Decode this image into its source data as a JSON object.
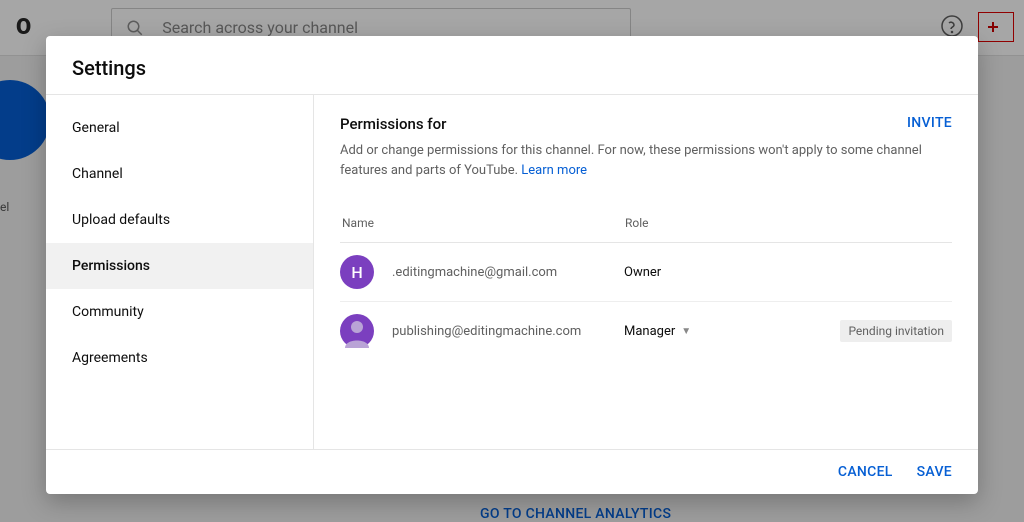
{
  "background": {
    "logo_text": "O",
    "search_placeholder": "Search across your channel",
    "channel_label": "el",
    "analytics_link": "GO TO CHANNEL ANALYTICS"
  },
  "modal": {
    "title": "Settings",
    "sidebar": {
      "items": [
        {
          "label": "General",
          "active": false
        },
        {
          "label": "Channel",
          "active": false
        },
        {
          "label": "Upload defaults",
          "active": false
        },
        {
          "label": "Permissions",
          "active": true
        },
        {
          "label": "Community",
          "active": false
        },
        {
          "label": "Agreements",
          "active": false
        }
      ]
    },
    "content": {
      "heading": "Permissions for",
      "invite_label": "INVITE",
      "description": "Add or change permissions for this channel. For now, these permissions won't apply to some channel features and parts of YouTube.",
      "learn_more": "Learn more",
      "table": {
        "headers": {
          "name": "Name",
          "role": "Role"
        },
        "rows": [
          {
            "avatar_letter": "H",
            "name": "",
            "email": ".editingmachine@gmail.com",
            "role": "Owner",
            "role_editable": false,
            "status": ""
          },
          {
            "avatar_letter": "",
            "name": "",
            "email": "publishing@editingmachine.com",
            "role": "Manager",
            "role_editable": true,
            "status": "Pending invitation"
          }
        ]
      }
    },
    "footer": {
      "cancel": "CANCEL",
      "save": "SAVE"
    }
  }
}
